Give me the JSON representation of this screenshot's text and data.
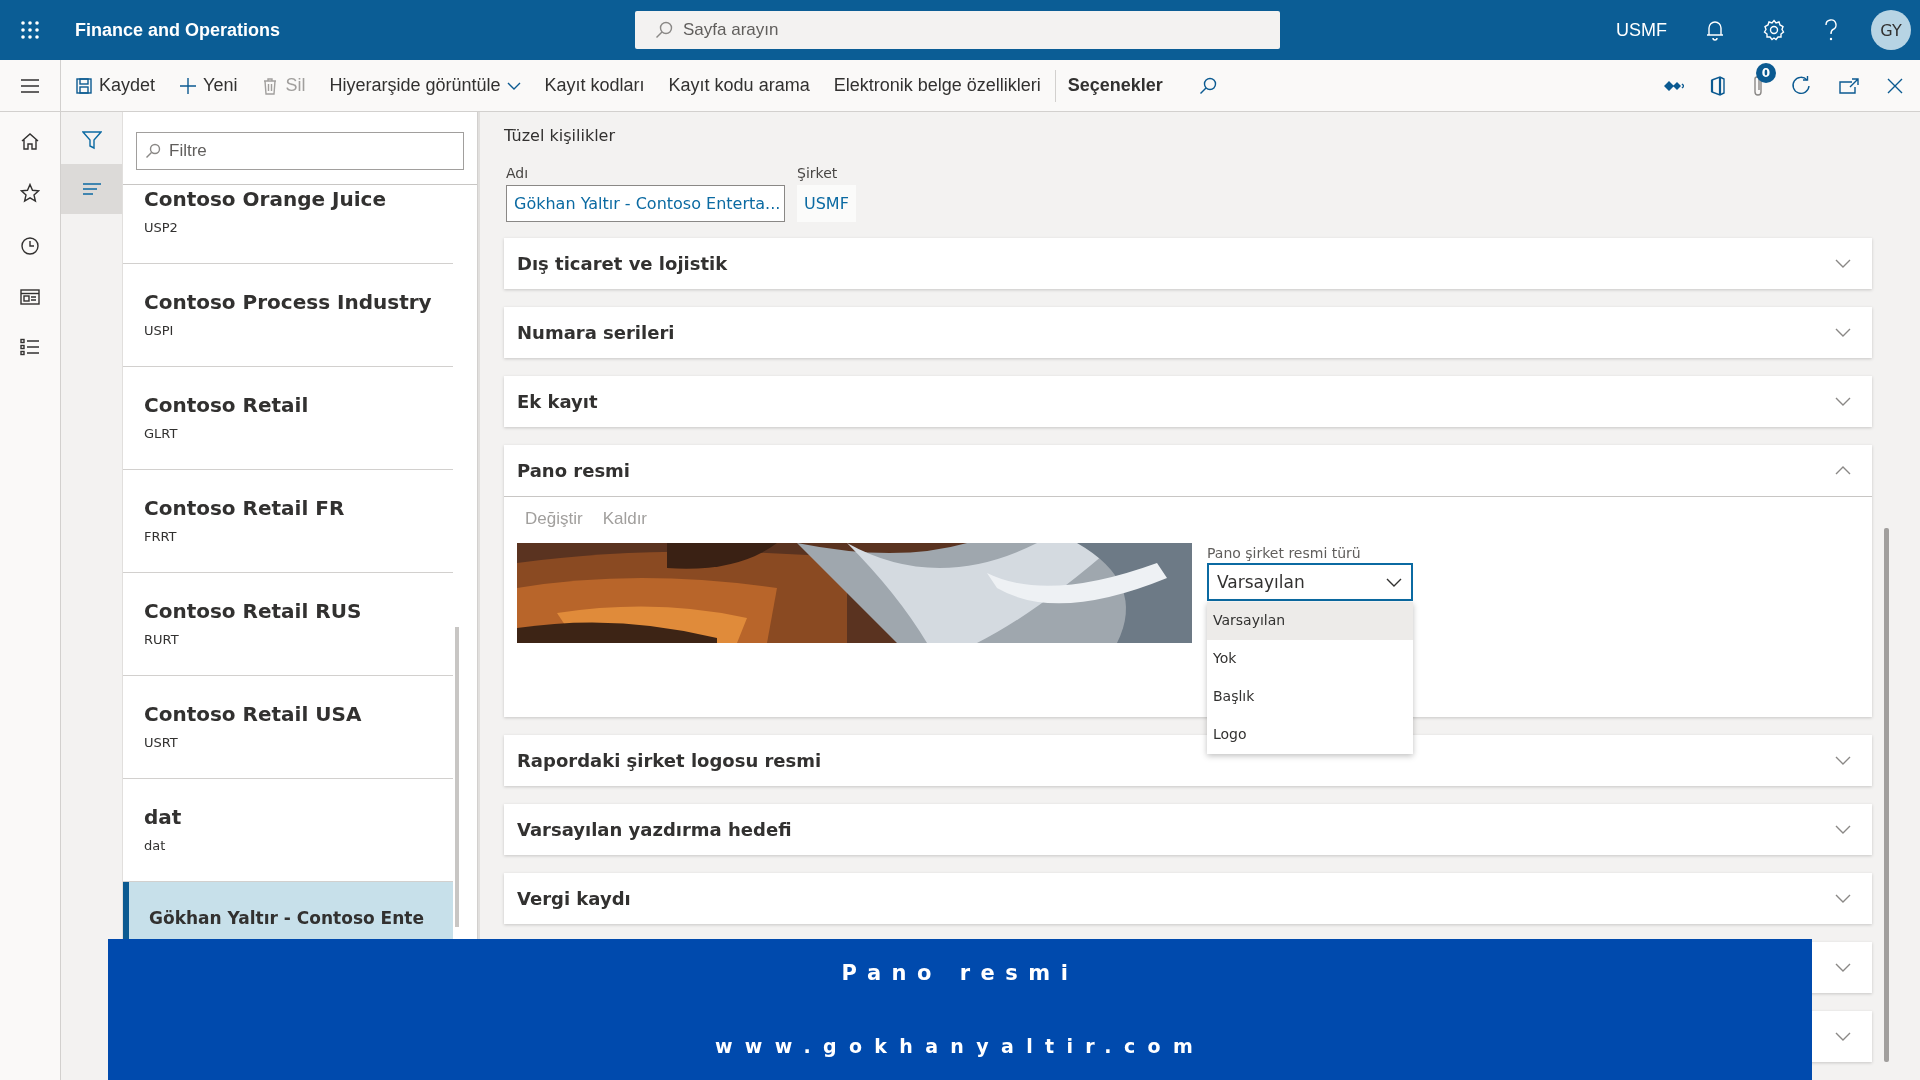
{
  "app": {
    "title": "Finance and Operations",
    "search_placeholder": "Sayfa arayın",
    "company": "USMF",
    "user_initials": "GY"
  },
  "toolbar": {
    "items": [
      {
        "kind": "save",
        "label": "Kaydet",
        "disabled": false
      },
      {
        "kind": "new",
        "label": "Yeni",
        "disabled": false
      },
      {
        "kind": "delete",
        "label": "Sil",
        "disabled": true
      },
      {
        "kind": "menu",
        "label": "Hiyerarşide görüntüle",
        "disabled": false
      },
      {
        "kind": "plain",
        "label": "Kayıt kodları",
        "disabled": false
      },
      {
        "kind": "plain",
        "label": "Kayıt kodu arama",
        "disabled": false
      },
      {
        "kind": "plain",
        "label": "Elektronik belge özellikleri",
        "disabled": false
      },
      {
        "kind": "emphasis",
        "label": "Seçenekler",
        "disabled": false
      }
    ],
    "attachments_count": "0"
  },
  "list": {
    "filter_placeholder": "Filtre",
    "items": [
      {
        "name": "Contoso Orange Juice",
        "code": "USP2",
        "selected": false
      },
      {
        "name": "Contoso Process Industry",
        "code": "USPI",
        "selected": false
      },
      {
        "name": "Contoso Retail",
        "code": "GLRT",
        "selected": false
      },
      {
        "name": "Contoso Retail FR",
        "code": "FRRT",
        "selected": false
      },
      {
        "name": "Contoso Retail RUS",
        "code": "RURT",
        "selected": false
      },
      {
        "name": "Contoso Retail USA",
        "code": "USRT",
        "selected": false
      },
      {
        "name": "dat",
        "code": "dat",
        "selected": false
      },
      {
        "name": "Gökhan Yaltır - Contoso Ente",
        "selected": true
      }
    ]
  },
  "header": {
    "title": "Tüzel kişilikler",
    "fields": [
      {
        "label": "Adı",
        "value": "Gökhan Yaltır - Contoso Enterta...",
        "kind": "input"
      },
      {
        "label": "Şirket",
        "value": "USMF",
        "kind": "link"
      }
    ]
  },
  "sections": [
    {
      "title": "Dış ticaret ve lojistik",
      "expanded": false
    },
    {
      "title": "Numara serileri",
      "expanded": false
    },
    {
      "title": "Ek kayıt",
      "expanded": false
    },
    {
      "title": "Pano resmi",
      "expanded": true,
      "content": {
        "actions": [
          {
            "label": "Değiştir",
            "disabled": true
          },
          {
            "label": "Kaldır",
            "disabled": true
          }
        ],
        "field": {
          "label": "Pano şirket resmi türü",
          "value": "Varsayılan",
          "open": true,
          "options": [
            {
              "label": "Varsayılan",
              "selected": true
            },
            {
              "label": "Yok",
              "selected": false
            },
            {
              "label": "Başlık",
              "selected": false
            },
            {
              "label": "Logo",
              "selected": false
            }
          ]
        }
      }
    },
    {
      "title": "Rapordaki şirket logosu resmi",
      "expanded": false
    },
    {
      "title": "Varsayılan yazdırma hedefi",
      "expanded": false
    },
    {
      "title": "Vergi kaydı",
      "expanded": false
    },
    {
      "expanded": false
    },
    {
      "expanded": false
    }
  ],
  "banner": {
    "title": "Pano resmi",
    "url": "www.gokhanyaltir.com"
  }
}
